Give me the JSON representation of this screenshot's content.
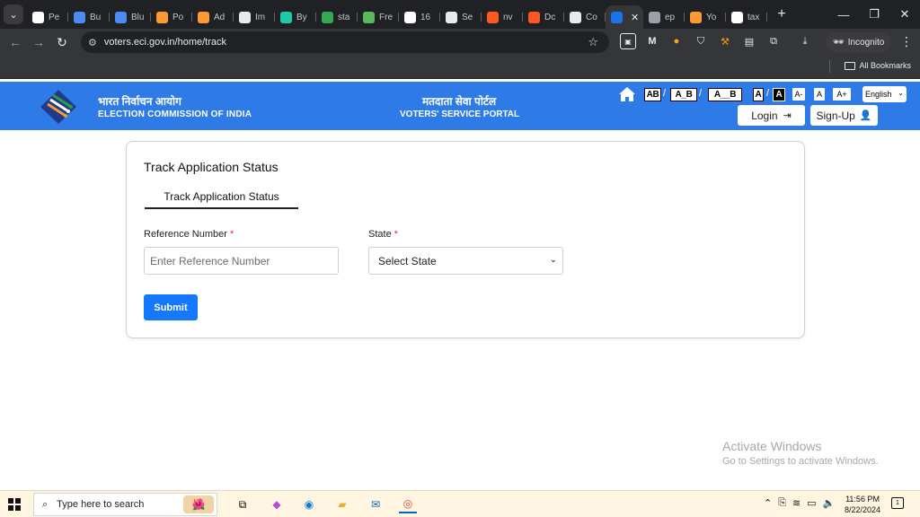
{
  "browser": {
    "tabs": [
      {
        "label": "Pe",
        "icon": "car-icon",
        "color": "#ffffff"
      },
      {
        "label": "Bu",
        "icon": "grid-icon",
        "color": "#4c8bf5"
      },
      {
        "label": "Blu",
        "icon": "grid-icon",
        "color": "#4c8bf5"
      },
      {
        "label": "Po",
        "icon": "india-flag-icon",
        "color": "#ff9933"
      },
      {
        "label": "Ad",
        "icon": "india-flag-icon",
        "color": "#ff9933"
      },
      {
        "label": "Im",
        "icon": "openai-icon",
        "color": "#e8eaed"
      },
      {
        "label": "By",
        "icon": "chat-icon",
        "color": "#1fc8a6"
      },
      {
        "label": "sta",
        "icon": "trend-icon",
        "color": "#34a853"
      },
      {
        "label": "Fre",
        "icon": "leaf-icon",
        "color": "#5bb85d"
      },
      {
        "label": "16",
        "icon": "google-icon",
        "color": "#ffffff"
      },
      {
        "label": "Se",
        "icon": "s-icon",
        "color": "#e8eaed"
      },
      {
        "label": "nv",
        "icon": "fox-icon",
        "color": "#ff5722"
      },
      {
        "label": "Dc",
        "icon": "fox-icon",
        "color": "#ff5722"
      },
      {
        "label": "Co",
        "icon": "cc-icon",
        "color": "#e8eaed"
      },
      {
        "label": "",
        "icon": "eci-icon",
        "color": "#1a73e8",
        "active": true
      },
      {
        "label": "ep",
        "icon": "globe-icon",
        "color": "#9aa0a6"
      },
      {
        "label": "Yo",
        "icon": "india-flag-icon",
        "color": "#ff9933"
      },
      {
        "label": "tax",
        "icon": "google-icon",
        "color": "#ffffff"
      }
    ],
    "url": "voters.eci.gov.in/home/track",
    "incognito_label": "Incognito",
    "bookmarks_label": "All Bookmarks"
  },
  "header": {
    "org_hindi": "भारत निर्वाचन आयोग",
    "org_english": "ELECTION COMMISSION OF INDIA",
    "portal_hindi": "मतदाता सेवा पोर्टल",
    "portal_english": "VOTERS' SERVICE PORTAL",
    "contrast_buttons": [
      "AB",
      "A_B",
      "A__B"
    ],
    "theme_buttons": [
      "A",
      "A"
    ],
    "font_buttons": [
      "A-",
      "A",
      "A+"
    ],
    "language": "English",
    "login_label": "Login",
    "signup_label": "Sign-Up"
  },
  "card": {
    "title": "Track Application Status",
    "tab_label": "Track Application Status",
    "ref_label": "Reference Number",
    "ref_placeholder": "Enter Reference Number",
    "state_label": "State",
    "required_mark": "*",
    "state_selected": "Select State",
    "submit_label": "Submit"
  },
  "watermark": {
    "line1": "Activate Windows",
    "line2": "Go to Settings to activate Windows."
  },
  "taskbar": {
    "search_placeholder": "Type here to search",
    "time": "11:56 PM",
    "date": "8/22/2024",
    "notification_count": "1"
  }
}
